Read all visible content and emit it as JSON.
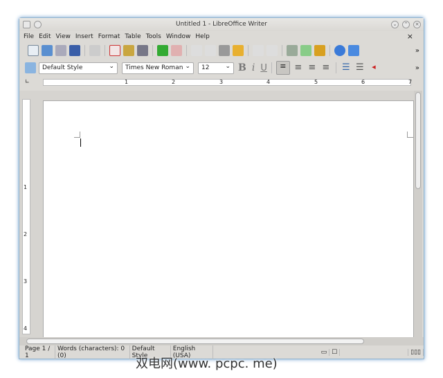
{
  "window": {
    "title": "Untitled 1 - LibreOffice Writer"
  },
  "menu": [
    "File",
    "Edit",
    "View",
    "Insert",
    "Format",
    "Table",
    "Tools",
    "Window",
    "Help"
  ],
  "close_doc": "×",
  "format": {
    "style": "Default Style",
    "font": "Times New Roman",
    "size": "12"
  },
  "more": "»",
  "ruler": [
    "1",
    "2",
    "3",
    "4",
    "5",
    "6",
    "7"
  ],
  "vruler": [
    "1",
    "2",
    "3",
    "4"
  ],
  "status": {
    "page": "Page 1 / 1",
    "words": "Words (characters): 0 (0)",
    "style": "Default Style",
    "language": "English (USA)"
  },
  "watermark": "双电网(www. pcpc. me)"
}
